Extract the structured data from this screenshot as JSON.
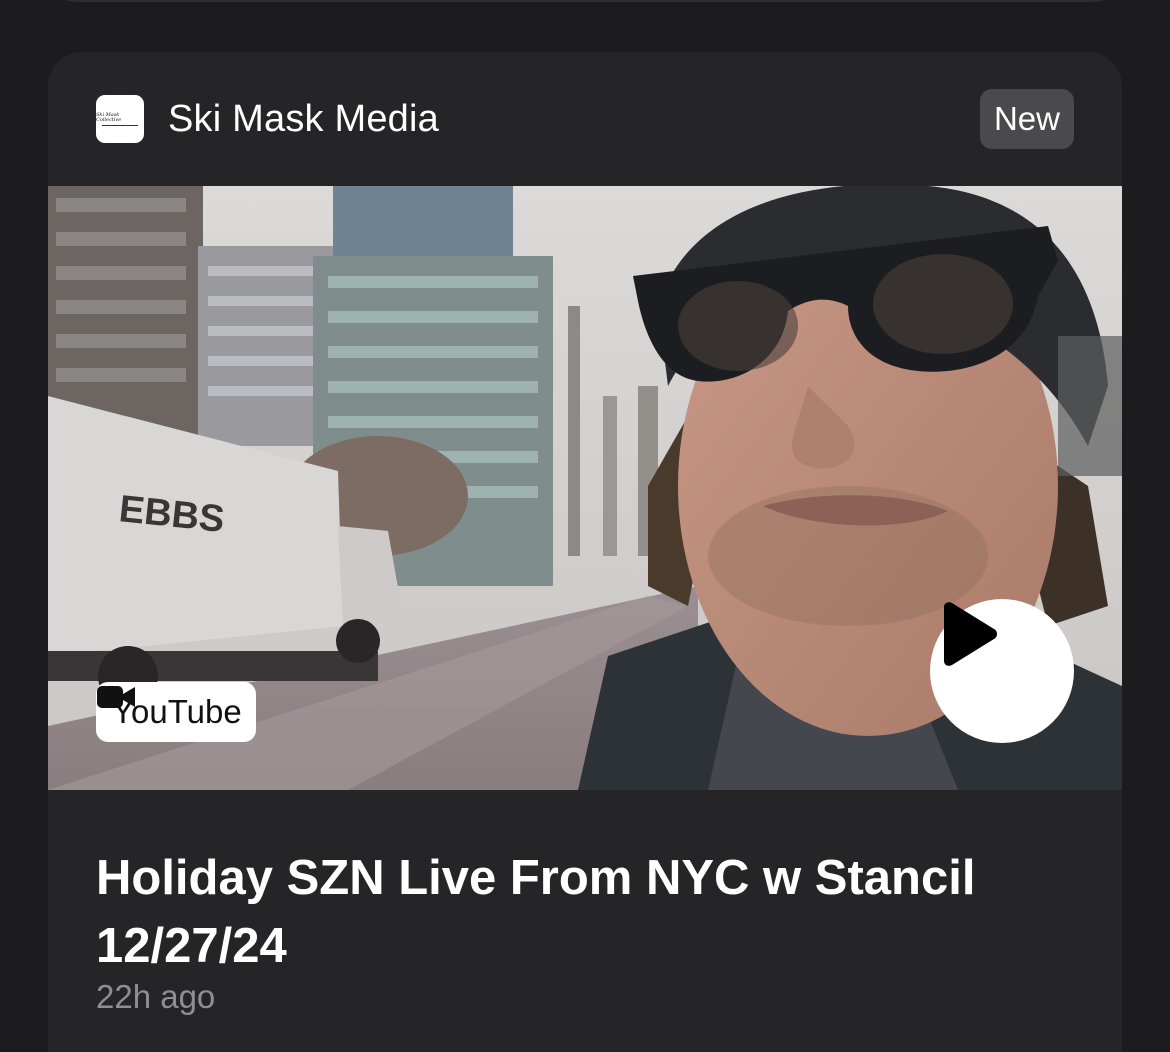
{
  "card": {
    "source": {
      "name": "Ski Mask Media",
      "logo_text": "Ski Mask Collective",
      "logo_icon": "ski-mask-media-logo"
    },
    "badge": "New",
    "thumbnail": {
      "platform_label": "YouTube",
      "platform_icon": "video-camera-icon",
      "play_icon": "play-icon",
      "truck_text": "EBBS"
    },
    "title": "Holiday SZN Live From NYC w Stancil 12/27/24",
    "time_ago": "22h ago"
  }
}
